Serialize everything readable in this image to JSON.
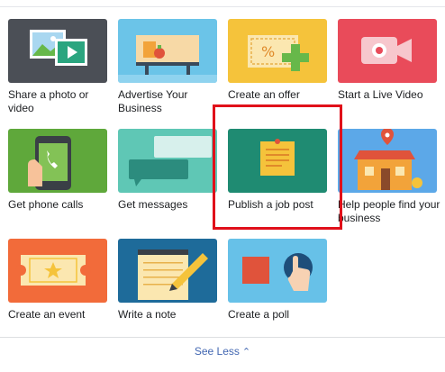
{
  "tiles": [
    {
      "label": "Share a photo or video",
      "bg": "#4b4f56",
      "icon": "photo-video-icon"
    },
    {
      "label": "Advertise Your Business",
      "bg": "#6bc4e8",
      "icon": "storefront-billboard-icon"
    },
    {
      "label": "Create an offer",
      "bg": "#f5c33b",
      "icon": "coupon-plus-icon"
    },
    {
      "label": "Start a Live Video",
      "bg": "#e94b5a",
      "icon": "live-camera-icon"
    },
    {
      "label": "Get phone calls",
      "bg": "#5fa83b",
      "icon": "phone-icon"
    },
    {
      "label": "Get messages",
      "bg": "#5fc7b5",
      "icon": "message-bubbles-icon"
    },
    {
      "label": "Publish a job post",
      "bg": "#1f8b72",
      "icon": "sticky-note-icon"
    },
    {
      "label": "Help people find your business",
      "bg": "#5ca8e8",
      "icon": "location-store-icon"
    },
    {
      "label": "Create an event",
      "bg": "#f26b3a",
      "icon": "ticket-star-icon"
    },
    {
      "label": "Write a note",
      "bg": "#1e6b9a",
      "icon": "notepad-pencil-icon"
    },
    {
      "label": "Create a poll",
      "bg": "#67c1e8",
      "icon": "poll-shapes-icon"
    }
  ],
  "footer": {
    "see_less": "See Less"
  }
}
